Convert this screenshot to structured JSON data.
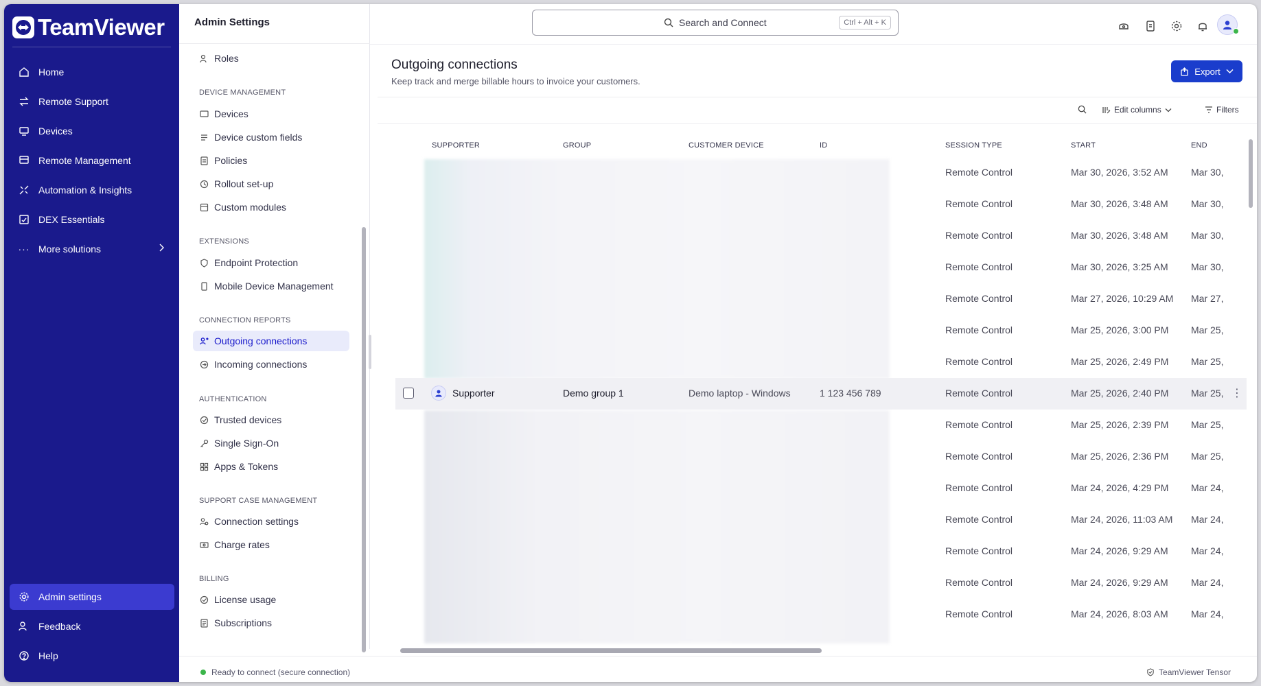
{
  "brand": {
    "name": "TeamViewer"
  },
  "nav": {
    "items": [
      {
        "label": "Home"
      },
      {
        "label": "Remote Support"
      },
      {
        "label": "Devices"
      },
      {
        "label": "Remote Management"
      },
      {
        "label": "Automation & Insights"
      },
      {
        "label": "DEX Essentials"
      },
      {
        "label": "More solutions"
      }
    ],
    "bottom": [
      {
        "label": "Admin settings"
      },
      {
        "label": "Feedback"
      },
      {
        "label": "Help"
      }
    ]
  },
  "settings": {
    "title": "Admin Settings",
    "roles": "Roles",
    "device_management": {
      "title": "DEVICE MANAGEMENT",
      "items": [
        "Devices",
        "Device custom fields",
        "Policies",
        "Rollout set-up",
        "Custom modules"
      ]
    },
    "extensions": {
      "title": "EXTENSIONS",
      "items": [
        "Endpoint Protection",
        "Mobile Device Management"
      ]
    },
    "connection_reports": {
      "title": "CONNECTION REPORTS",
      "items": [
        "Outgoing connections",
        "Incoming connections"
      ]
    },
    "authentication": {
      "title": "AUTHENTICATION",
      "items": [
        "Trusted devices",
        "Single Sign-On",
        "Apps & Tokens"
      ]
    },
    "support_case_management": {
      "title": "SUPPORT CASE MANAGEMENT",
      "items": [
        "Connection settings",
        "Charge rates"
      ]
    },
    "billing": {
      "title": "BILLING",
      "items": [
        "License usage",
        "Subscriptions"
      ]
    }
  },
  "search": {
    "label": "Search and Connect",
    "shortcut": "Ctrl + Alt + K"
  },
  "page": {
    "title": "Outgoing connections",
    "subtitle": "Keep track and merge billable hours to invoice your customers.",
    "export_label": "Export",
    "edit_columns_label": "Edit columns",
    "filters_label": "Filters"
  },
  "table": {
    "columns": [
      "SUPPORTER",
      "GROUP",
      "CUSTOMER DEVICE",
      "ID",
      "SESSION TYPE",
      "START",
      "END"
    ],
    "rows": [
      {
        "session_type": "Remote Control",
        "start": "Mar 30, 2026, 3:52 AM",
        "end": "Mar 30,"
      },
      {
        "session_type": "Remote Control",
        "start": "Mar 30, 2026, 3:48 AM",
        "end": "Mar 30,"
      },
      {
        "session_type": "Remote Control",
        "start": "Mar 30, 2026, 3:48 AM",
        "end": "Mar 30,"
      },
      {
        "session_type": "Remote Control",
        "start": "Mar 30, 2026, 3:25 AM",
        "end": "Mar 30,"
      },
      {
        "session_type": "Remote Control",
        "start": "Mar 27, 2026, 10:29 AM",
        "end": "Mar 27,"
      },
      {
        "session_type": "Remote Control",
        "start": "Mar 25, 2026, 3:00 PM",
        "end": "Mar 25,"
      },
      {
        "session_type": "Remote Control",
        "start": "Mar 25, 2026, 2:49 PM",
        "end": "Mar 25,"
      },
      {
        "supporter": "Supporter",
        "group": "Demo group 1",
        "customer_device": "Demo laptop - Windows",
        "id": "1 123 456 789",
        "session_type": "Remote Control",
        "start": "Mar 25, 2026, 2:40 PM",
        "end": "Mar 25,"
      },
      {
        "session_type": "Remote Control",
        "start": "Mar 25, 2026, 2:39 PM",
        "end": "Mar 25,"
      },
      {
        "session_type": "Remote Control",
        "start": "Mar 25, 2026, 2:36 PM",
        "end": "Mar 25,"
      },
      {
        "session_type": "Remote Control",
        "start": "Mar 24, 2026, 4:29 PM",
        "end": "Mar 24,"
      },
      {
        "session_type": "Remote Control",
        "start": "Mar 24, 2026, 11:03 AM",
        "end": "Mar 24,"
      },
      {
        "session_type": "Remote Control",
        "start": "Mar 24, 2026, 9:29 AM",
        "end": "Mar 24,"
      },
      {
        "session_type": "Remote Control",
        "start": "Mar 24, 2026, 9:29 AM",
        "end": "Mar 24,"
      },
      {
        "session_type": "Remote Control",
        "start": "Mar 24, 2026, 8:03 AM",
        "end": "Mar 24,"
      }
    ]
  },
  "footer": {
    "status": "Ready to connect (secure connection)",
    "tensor": "TeamViewer Tensor"
  },
  "colors": {
    "sidebar": "#1a1a8c",
    "accent": "#1a3dcc",
    "active_nav": "#3b3bd0",
    "online": "#3bb54a"
  }
}
